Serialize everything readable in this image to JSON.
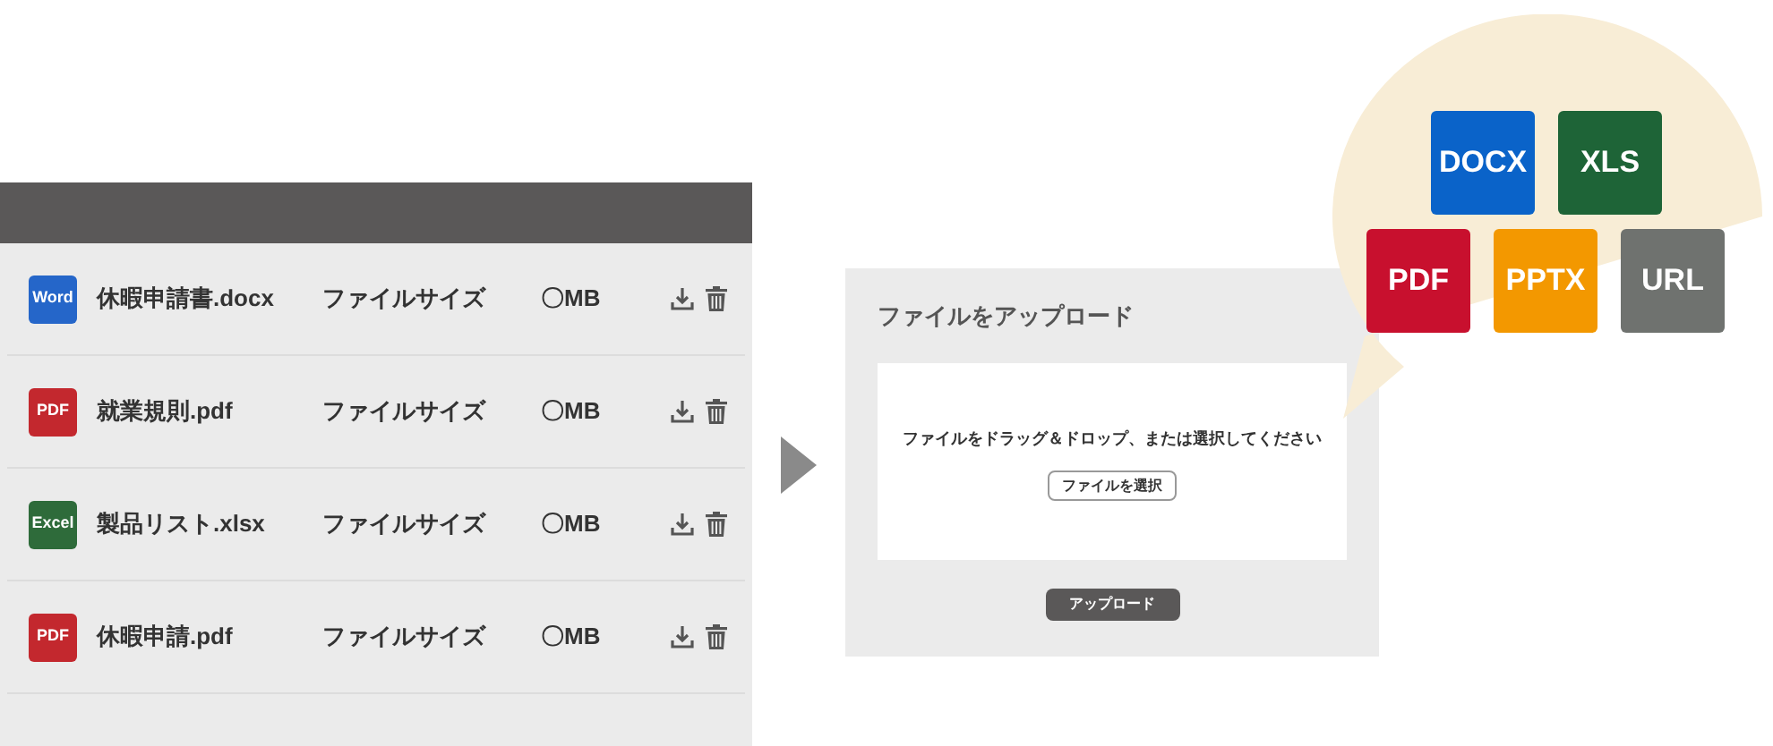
{
  "file_list": {
    "rows": [
      {
        "icon_label": "Word",
        "color": "#2566c9",
        "name": "休暇申請書.docx",
        "size_label": "ファイルサイズ",
        "size": "〇MB"
      },
      {
        "icon_label": "PDF",
        "color": "#c3282e",
        "name": "就業規則.pdf",
        "size_label": "ファイルサイズ",
        "size": "〇MB"
      },
      {
        "icon_label": "Excel",
        "color": "#2e6b3a",
        "name": "製品リスト.xlsx",
        "size_label": "ファイルサイズ",
        "size": "〇MB"
      },
      {
        "icon_label": "PDF",
        "color": "#c3282e",
        "name": "休暇申請.pdf",
        "size_label": "ファイルサイズ",
        "size": "〇MB"
      }
    ]
  },
  "upload_panel": {
    "title": "ファイルをアップロード",
    "drop_message": "ファイルをドラッグ＆ドロップ、または選択してください",
    "select_button": "ファイルを選択",
    "upload_button": "アップロード"
  },
  "format_bubble": {
    "formats": [
      {
        "label": "DOCX",
        "color": "#0a63c9"
      },
      {
        "label": "XLS",
        "color": "#1e6437"
      },
      {
        "label": "PDF",
        "color": "#c8102e"
      },
      {
        "label": "PPTX",
        "color": "#f39800"
      },
      {
        "label": "URL",
        "color": "#6f726f"
      }
    ]
  }
}
